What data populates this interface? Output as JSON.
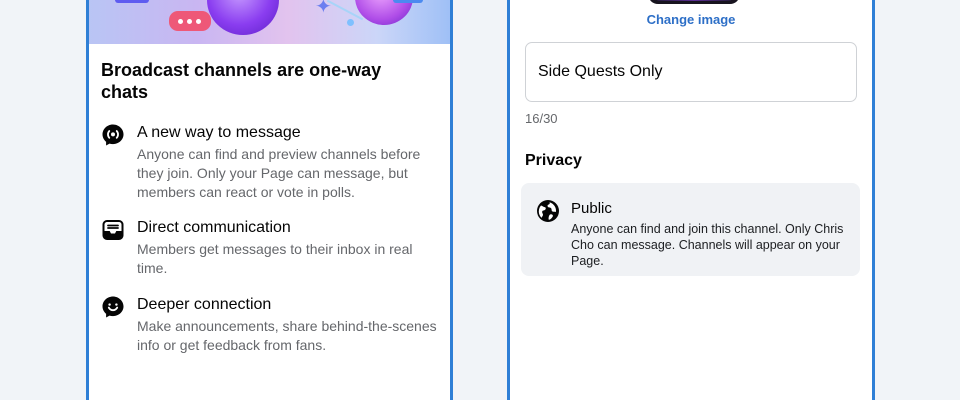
{
  "left_screen": {
    "title": "Broadcast channels are one-way chats",
    "features": [
      {
        "icon": "broadcast-icon",
        "heading": "A new way to message",
        "description": "Anyone can find and preview channels before they join. Only your Page can message, but members can react or vote in polls."
      },
      {
        "icon": "inbox-icon",
        "heading": "Direct communication",
        "description": "Members get messages to their inbox in real time."
      },
      {
        "icon": "smile-chat-icon",
        "heading": "Deeper connection",
        "description": "Make announcements, share behind-the-scenes info or get feedback from fans."
      }
    ]
  },
  "right_screen": {
    "change_image_label": "Change image",
    "channel_name_value": "Side Quests Only",
    "char_counter": "16/30",
    "privacy_heading": "Privacy",
    "privacy_option": {
      "icon": "globe-icon",
      "title": "Public",
      "description": "Anyone can find and join this channel. Only Chris Cho can message. Channels will appear on your Page."
    }
  },
  "colors": {
    "accent_border": "#2f7fd6",
    "link_blue": "#2d6fc7",
    "background": "#f1f4f8",
    "card_gray": "#f0f2f5"
  }
}
